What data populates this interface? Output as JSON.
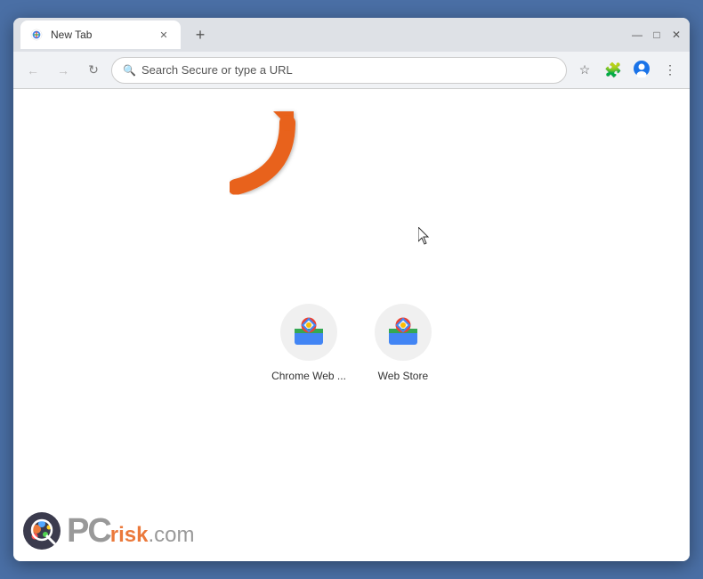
{
  "browser": {
    "tab": {
      "title": "New Tab",
      "favicon": "chrome-icon"
    },
    "new_tab_button": "+",
    "window_controls": {
      "minimize": "—",
      "maximize": "□",
      "close": "✕"
    }
  },
  "toolbar": {
    "back_label": "←",
    "forward_label": "→",
    "reload_label": "↻",
    "address_placeholder": "Search Secure or type a URL",
    "bookmark_icon": "★",
    "extensions_icon": "🧩",
    "profile_icon": "👤",
    "menu_icon": "⋮"
  },
  "content": {
    "shortcuts": [
      {
        "label": "Chrome Web ...",
        "icon": "chrome-webstore-icon"
      },
      {
        "label": "Web Store",
        "icon": "chrome-webstore-icon-2"
      }
    ]
  },
  "watermark": {
    "pc_text": "PC",
    "risk_text": "risk",
    "dot_com": ".com"
  },
  "arrow": {
    "color": "#e8621a"
  }
}
